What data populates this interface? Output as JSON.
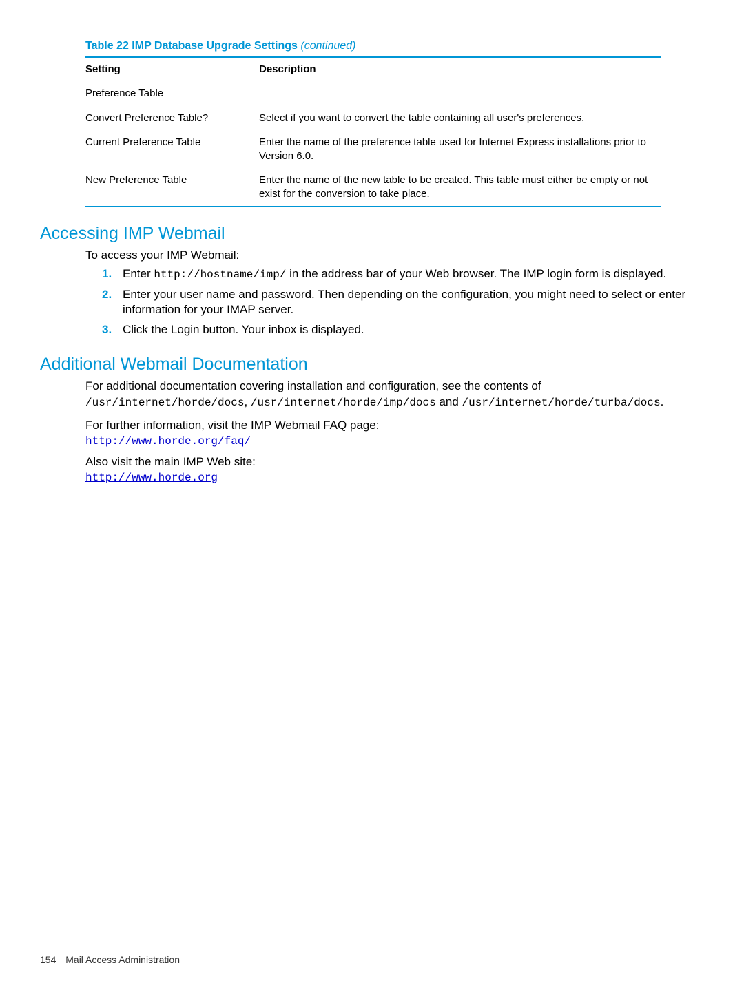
{
  "table": {
    "caption_prefix": "Table 22 IMP Database Upgrade Settings ",
    "caption_continued": "(continued)",
    "headers": {
      "col1": "Setting",
      "col2": "Description"
    },
    "rows": [
      {
        "setting": "Preference Table",
        "description": ""
      },
      {
        "setting": "Convert Preference Table?",
        "description": "Select if you want to convert the table containing all user's preferences."
      },
      {
        "setting": "Current Preference Table",
        "description": "Enter the name of the preference table used for Internet Express installations prior to Version 6.0."
      },
      {
        "setting": "New Preference Table",
        "description": "Enter the name of the new table to be created. This table must either be empty or not exist for the conversion to take place."
      }
    ]
  },
  "section1": {
    "heading": "Accessing IMP Webmail",
    "intro": "To access your IMP Webmail:",
    "steps": [
      {
        "num": "1.",
        "pre": "Enter ",
        "code": "http://hostname/imp/",
        "post": " in the address bar of your Web browser. The IMP login form is displayed."
      },
      {
        "num": "2.",
        "text": "Enter your user name and password. Then depending on the configuration, you might need to select or enter information for your IMAP server."
      },
      {
        "num": "3.",
        "text": "Click the Login button. Your inbox is displayed."
      }
    ]
  },
  "section2": {
    "heading": "Additional Webmail Documentation",
    "para1_pre": "For additional documentation covering installation and configuration, see the contents of ",
    "para1_code1": "/usr/internet/horde/docs",
    "para1_mid1": ", ",
    "para1_code2": "/usr/internet/horde/imp/docs",
    "para1_mid2": " and ",
    "para1_code3": "/usr/internet/horde/turba/docs",
    "para1_post": ".",
    "para2": "For further information, visit the IMP Webmail FAQ page:",
    "link1": "http://www.horde.org/faq/",
    "para3": "Also visit the main IMP Web site:",
    "link2": "http://www.horde.org"
  },
  "footer": {
    "page": "154",
    "chapter": "Mail Access Administration"
  }
}
